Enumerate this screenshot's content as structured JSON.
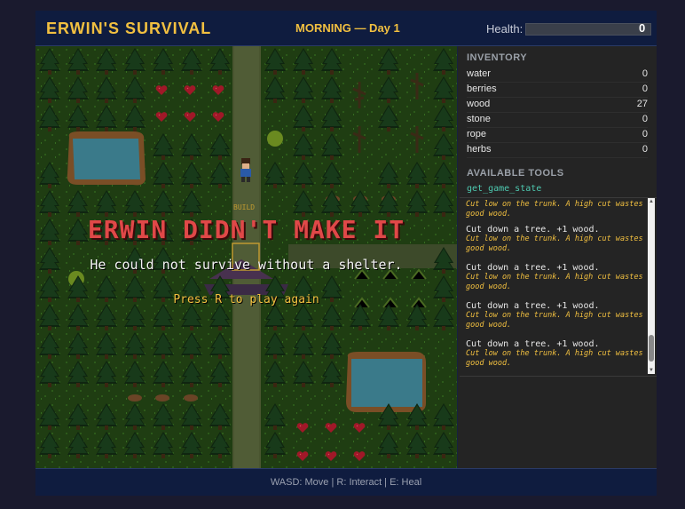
{
  "header": {
    "title": "ERWIN'S SURVIVAL",
    "phase": "MORNING — Day 1",
    "health_label": "Health:",
    "health_value": "0",
    "health_fraction": 0
  },
  "map": {
    "build_label": "BUILD",
    "overlay": {
      "title": "ERWIN DIDN'T MAKE IT",
      "subtitle": "He could not survive without a shelter.",
      "hint": "Press R to play again"
    }
  },
  "inventory": {
    "title": "INVENTORY",
    "items": [
      {
        "name": "water",
        "value": "0"
      },
      {
        "name": "berries",
        "value": "0"
      },
      {
        "name": "wood",
        "value": "27"
      },
      {
        "name": "stone",
        "value": "0"
      },
      {
        "name": "rope",
        "value": "0"
      },
      {
        "name": "herbs",
        "value": "0"
      }
    ]
  },
  "tools": {
    "title": "AVAILABLE TOOLS",
    "items": [
      "get_game_state"
    ]
  },
  "log": {
    "entries": [
      {
        "message": "",
        "tip": "Cut low on the trunk. A high cut wastes good wood."
      },
      {
        "message": "Cut down a tree. +1 wood.",
        "tip": "Cut low on the trunk. A high cut wastes good wood."
      },
      {
        "message": "Cut down a tree. +1 wood.",
        "tip": "Cut low on the trunk. A high cut wastes good wood."
      },
      {
        "message": "Cut down a tree. +1 wood.",
        "tip": "Cut low on the trunk. A high cut wastes good wood."
      },
      {
        "message": "Cut down a tree. +1 wood.",
        "tip": "Cut low on the trunk. A high cut wastes good wood."
      }
    ]
  },
  "footer": {
    "controls": "WASD: Move | R: Interact | E: Heal"
  },
  "colors": {
    "accent": "#f2c040",
    "danger": "#e04848",
    "tool": "#4ec9b0",
    "background": "#1a1a2e"
  }
}
